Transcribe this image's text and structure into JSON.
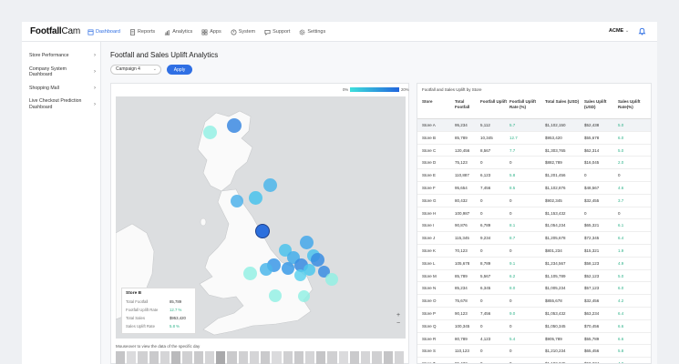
{
  "app": {
    "logo_bold": "Footfall",
    "logo_rest": "Cam",
    "account": "ACME",
    "account_chevron": "⌄"
  },
  "nav": [
    {
      "label": "Dashboard",
      "icon": "dashboard-icon",
      "active": true
    },
    {
      "label": "Reports",
      "icon": "reports-icon"
    },
    {
      "label": "Analytics",
      "icon": "analytics-icon"
    },
    {
      "label": "Apps",
      "icon": "apps-icon"
    },
    {
      "label": "System",
      "icon": "system-icon"
    },
    {
      "label": "Support",
      "icon": "support-icon"
    },
    {
      "label": "Settings",
      "icon": "settings-icon"
    }
  ],
  "sidebar": {
    "items": [
      {
        "label": "Store Performance"
      },
      {
        "label": "Company System Dashboard"
      },
      {
        "label": "Shopping Mall"
      },
      {
        "label": "Live Checkout Prediction Dashboard"
      }
    ]
  },
  "page": {
    "title": "Footfall and Sales Uplift Analytics",
    "campaign": "Campaign 4",
    "apply": "Apply"
  },
  "map": {
    "legend_min": "0%",
    "legend_max": "20%",
    "zoom_in": "+",
    "zoom_out": "−",
    "hint": "Mouseover to view the data of the specific day",
    "tooltip": {
      "title": "Store B",
      "rows": [
        {
          "label": "Total Footfall",
          "value": "85,789"
        },
        {
          "label": "Footfall Uplift Rate",
          "value": "12.7 %",
          "green": true
        },
        {
          "label": "Total Sales",
          "value": "$953,420"
        },
        {
          "label": "Sales Uplift Rate",
          "value": "5.8 %",
          "green": true
        }
      ]
    },
    "day_levels": [
      0.35,
      0.15,
      0.25,
      0.3,
      0.2,
      0.45,
      0.25,
      0.3,
      0.2,
      0.6,
      0.3,
      0.25,
      0.2,
      0.3,
      0.15,
      0.25,
      0.3,
      0.2,
      0.35,
      0.25,
      0.15,
      0.3,
      0.2,
      0.25,
      0.35,
      0.2
    ]
  },
  "table": {
    "title": "Footfall and Sales Uplift by Store",
    "headers": [
      "Store",
      "Total Footfall",
      "Footfall Uplift",
      "Footfall Uplift Rate (%)",
      "Total Sales (USD)",
      "Sales Uplift (USD)",
      "Sales Uplift Rate(%)"
    ],
    "rows": [
      [
        "Store A",
        "95,234",
        "5,112",
        "5.7",
        "$1,102,150",
        "$52,438",
        "5.0"
      ],
      [
        "Store B",
        "85,789",
        "10,345",
        "12.7",
        "$953,420",
        "$55,678",
        "6.0"
      ],
      [
        "Store C",
        "120,456",
        "8,567",
        "7.7",
        "$1,303,765",
        "$62,314",
        "5.0"
      ],
      [
        "Store D",
        "75,123",
        "0",
        "0",
        "$882,789",
        "$16,045",
        "2.0"
      ],
      [
        "Store E",
        "110,887",
        "6,123",
        "5.8",
        "$1,201,456",
        "0",
        "0"
      ],
      [
        "Store F",
        "95,654",
        "7,456",
        "8.5",
        "$1,102,876",
        "$48,567",
        "4.6"
      ],
      [
        "Store G",
        "80,432",
        "0",
        "0",
        "$902,345",
        "$32,455",
        "3.7"
      ],
      [
        "Store H",
        "100,987",
        "0",
        "0",
        "$1,153,432",
        "0",
        "0"
      ],
      [
        "Store I",
        "90,876",
        "6,789",
        "8.1",
        "$1,054,234",
        "$65,321",
        "6.1"
      ],
      [
        "Store J",
        "115,345",
        "9,234",
        "8.7",
        "$1,205,678",
        "$72,345",
        "6.4"
      ],
      [
        "Store K",
        "70,123",
        "0",
        "0",
        "$801,234",
        "$15,321",
        "1.9"
      ],
      [
        "Store L",
        "105,678",
        "8,789",
        "9.1",
        "$1,234,567",
        "$58,123",
        "4.9"
      ],
      [
        "Store M",
        "85,789",
        "5,567",
        "6.2",
        "$1,105,789",
        "$52,123",
        "5.0"
      ],
      [
        "Store N",
        "85,234",
        "6,345",
        "8.0",
        "$1,005,234",
        "$57,123",
        "6.0"
      ],
      [
        "Store O",
        "75,678",
        "0",
        "0",
        "$855,678",
        "$32,456",
        "4.2"
      ],
      [
        "Store P",
        "90,123",
        "7,456",
        "9.0",
        "$1,053,432",
        "$63,234",
        "6.4"
      ],
      [
        "Store Q",
        "100,345",
        "0",
        "0",
        "$1,050,345",
        "$70,456",
        "6.6"
      ],
      [
        "Store R",
        "80,789",
        "4,123",
        "5.4",
        "$905,789",
        "$55,789",
        "6.6"
      ],
      [
        "Store S",
        "110,123",
        "0",
        "0",
        "$1,210,234",
        "$65,456",
        "5.8"
      ],
      [
        "Store T",
        "95,432",
        "0",
        "0",
        "$1,102,345",
        "$50,234",
        "4.8"
      ]
    ],
    "green_columns": [
      3,
      6
    ]
  },
  "colors": {
    "accent": "#2f6fe4",
    "positive": "#2fb38a"
  }
}
